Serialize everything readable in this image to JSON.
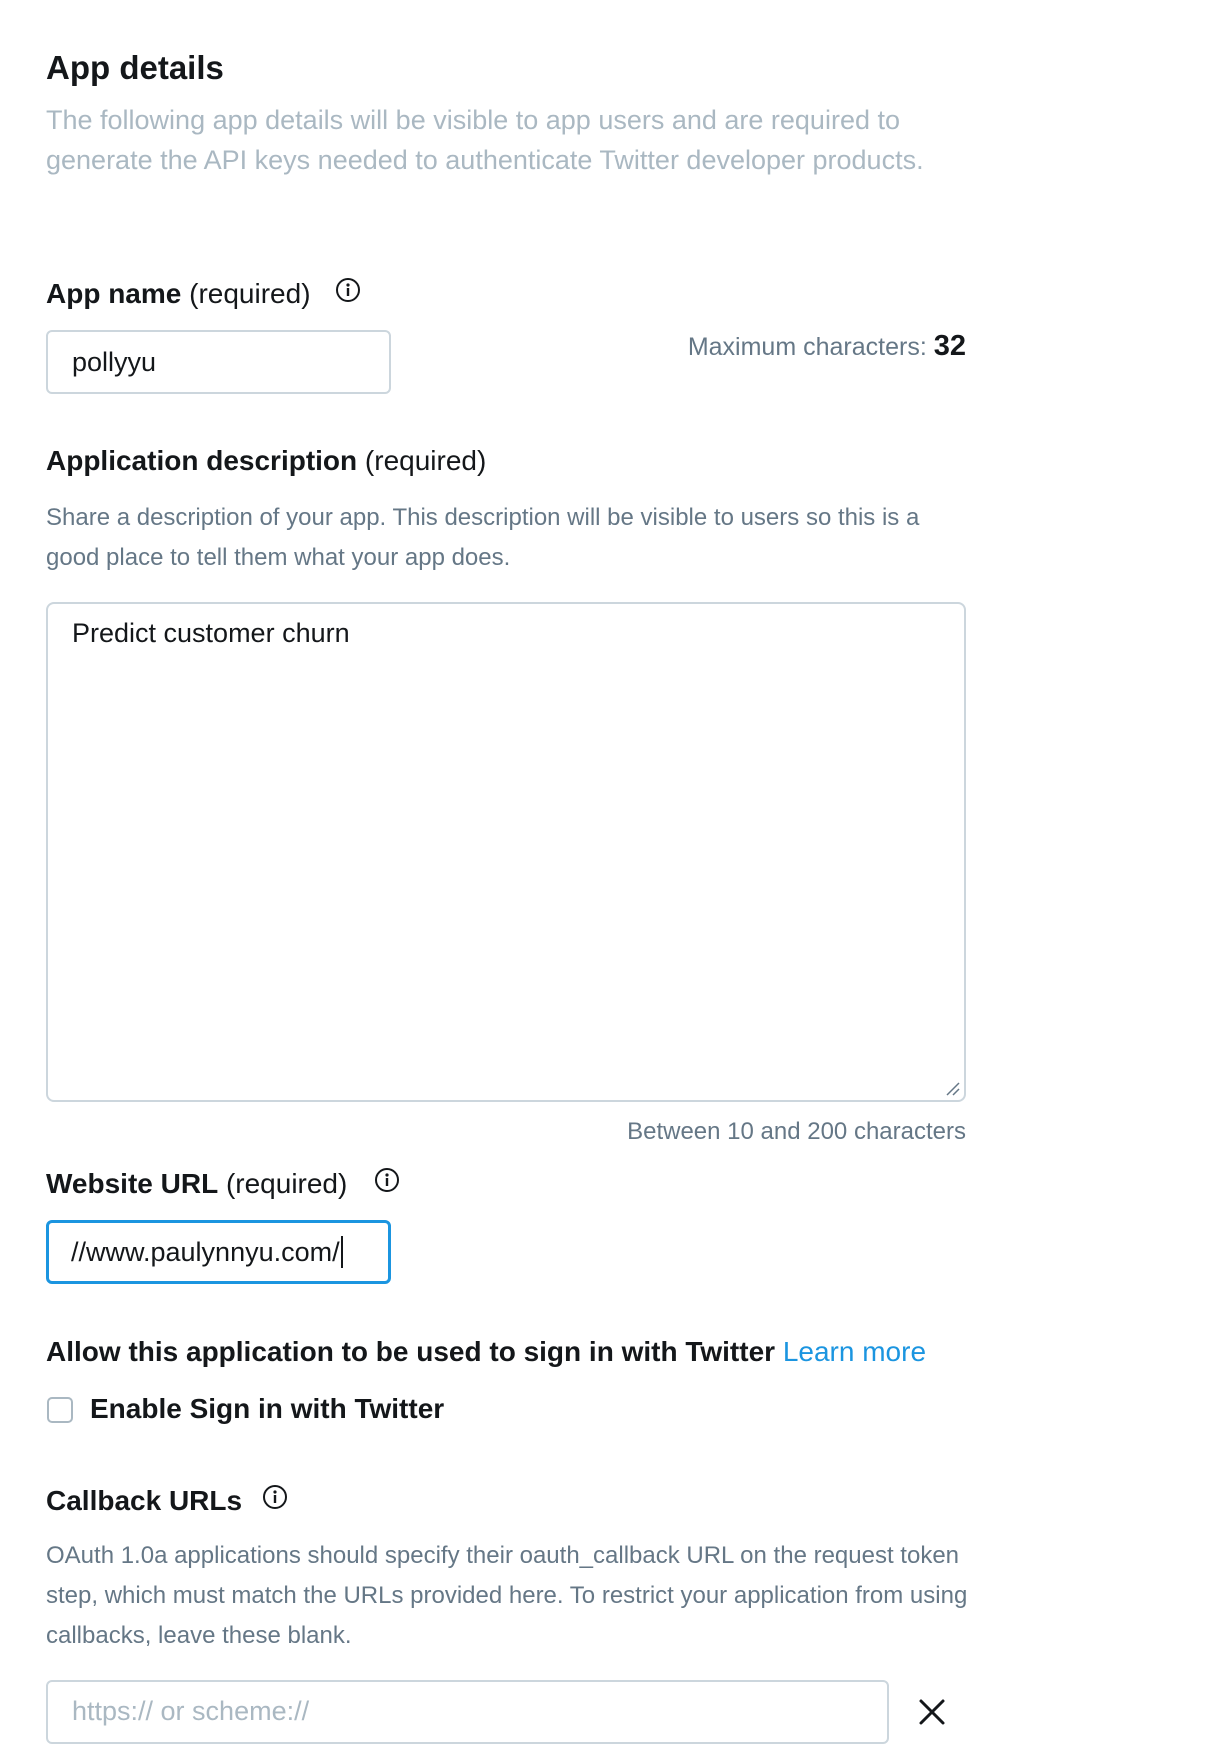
{
  "app_details": {
    "title": "App details",
    "description": "The following app details will be visible to app users and are required to generate the API keys needed to authenticate Twitter developer products."
  },
  "app_name": {
    "label": "App name",
    "required": "(required)",
    "value": "pollyyu",
    "max_label": "Maximum characters:",
    "max_value": "32"
  },
  "app_description": {
    "label": "Application description",
    "required": "(required)",
    "helper": "Share a description of your app. This description will be visible to users so this is a good place to tell them what your app does.",
    "value": "Predict customer churn",
    "limit": "Between 10 and 200 characters"
  },
  "website_url": {
    "label": "Website URL",
    "required": "(required)",
    "value": "//www.paulynnyu.com/"
  },
  "sign_in": {
    "heading": "Allow this application to be used to sign in with Twitter",
    "learn_more": "Learn more",
    "checkbox_label": "Enable Sign in with Twitter",
    "checked": false
  },
  "callback": {
    "label": "Callback URLs",
    "helper": "OAuth 1.0a applications should specify their oauth_callback URL on the request token step, which must match the URLs provided here. To restrict your application from using callbacks, leave these blank.",
    "placeholder": "https:// or scheme://"
  },
  "icons": {
    "info": "info-icon",
    "close": "close-icon",
    "resize": "resize-handle-icon"
  },
  "colors": {
    "accent": "#1b95e0",
    "muted": "#657786",
    "light_text": "#aab8c2",
    "border": "#ccd6dd"
  }
}
